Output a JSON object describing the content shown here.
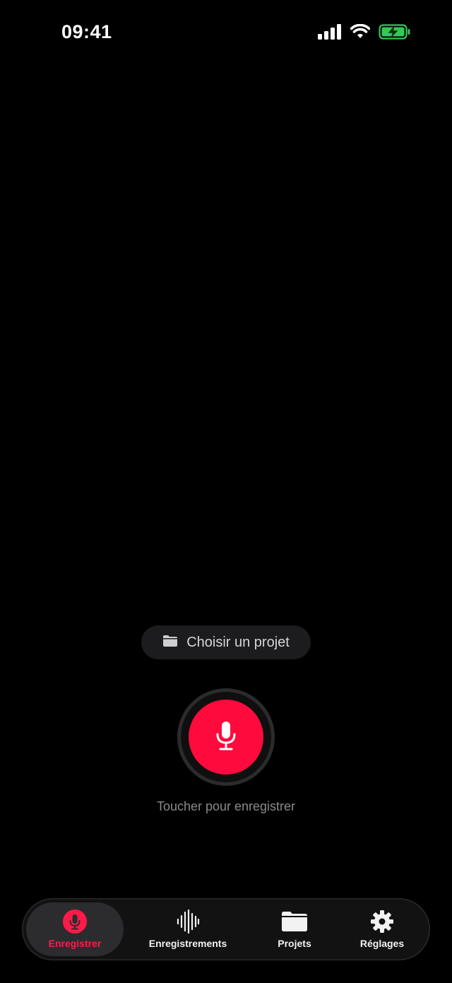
{
  "status_bar": {
    "time": "09:41",
    "icons": [
      "cellular-signal-icon",
      "wifi-icon",
      "battery-charging-icon"
    ]
  },
  "main": {
    "project_button": {
      "label": "Choisir un projet",
      "icon": "folder-icon"
    },
    "record_button": {
      "icon": "microphone-icon",
      "color": "#ff0a3c"
    },
    "hint": "Toucher pour enregistrer"
  },
  "tab_bar": {
    "accent_color": "#ff1a4a",
    "tabs": [
      {
        "label": "Enregistrer",
        "icon": "microphone-icon",
        "active": true
      },
      {
        "label": "Enregistrements",
        "icon": "waveform-icon",
        "active": false
      },
      {
        "label": "Projets",
        "icon": "folder-icon",
        "active": false
      },
      {
        "label": "Réglages",
        "icon": "gear-icon",
        "active": false
      }
    ]
  }
}
